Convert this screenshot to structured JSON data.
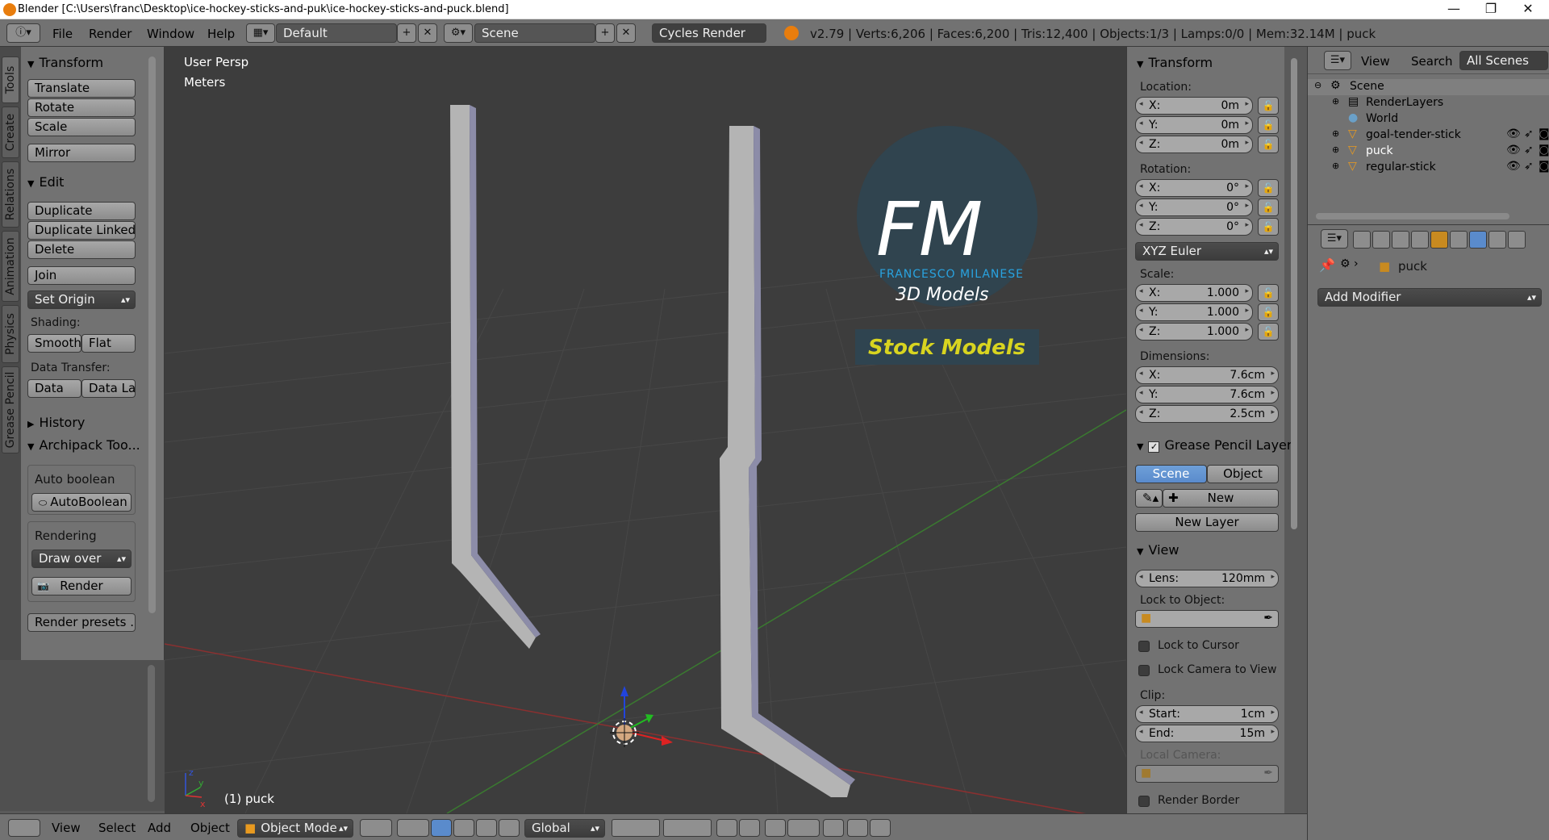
{
  "window": {
    "title": "Blender [C:\\Users\\franc\\Desktop\\ice-hockey-sticks-and-puk\\ice-hockey-sticks-and-puck.blend]",
    "minimize": "—",
    "maximize": "❐",
    "close": "✕"
  },
  "header": {
    "menus": [
      "File",
      "Render",
      "Window",
      "Help"
    ],
    "layout": "Default",
    "scene": "Scene",
    "engine": "Cycles Render",
    "stats": "v2.79 | Verts:6,206 | Faces:6,200 | Tris:12,400 | Objects:1/3 | Lamps:0/0 | Mem:32.14M | puck"
  },
  "side_tabs": [
    "Tools",
    "Create",
    "Relations",
    "Animation",
    "Physics",
    "Grease Pencil"
  ],
  "toolshelf": {
    "transform_title": "Transform",
    "transform_buttons": [
      "Translate",
      "Rotate",
      "Scale",
      "Mirror"
    ],
    "edit_title": "Edit",
    "edit_buttons": [
      "Duplicate",
      "Duplicate Linked",
      "Delete",
      "Join"
    ],
    "set_origin": "Set Origin",
    "shading_label": "Shading:",
    "smooth": "Smooth",
    "flat": "Flat",
    "data_transfer_label": "Data Transfer:",
    "data": "Data",
    "data_la": "Data La",
    "history_title": "History",
    "archipack_title": "Archipack Too...",
    "auto_boolean_label": "Auto boolean",
    "auto_boolean_btn": "AutoBoolean",
    "rendering_label": "Rendering",
    "draw_over": "Draw over",
    "render_btn": "Render",
    "render_presets": "Render presets ..."
  },
  "viewport": {
    "view_name": "User Persp",
    "units": "Meters",
    "active_object": "(1) puck",
    "logo_letters": "FM",
    "logo_name": "FRANCESCO MILANESE",
    "logo_sub": "3D Models",
    "logo_banner": "Stock Models"
  },
  "npanel": {
    "transform_title": "Transform",
    "location_label": "Location:",
    "location": [
      {
        "k": "X:",
        "v": "0m"
      },
      {
        "k": "Y:",
        "v": "0m"
      },
      {
        "k": "Z:",
        "v": "0m"
      }
    ],
    "rotation_label": "Rotation:",
    "rotation": [
      {
        "k": "X:",
        "v": "0°"
      },
      {
        "k": "Y:",
        "v": "0°"
      },
      {
        "k": "Z:",
        "v": "0°"
      }
    ],
    "rotation_mode": "XYZ Euler",
    "scale_label": "Scale:",
    "scale": [
      {
        "k": "X:",
        "v": "1.000"
      },
      {
        "k": "Y:",
        "v": "1.000"
      },
      {
        "k": "Z:",
        "v": "1.000"
      }
    ],
    "dimensions_label": "Dimensions:",
    "dimensions": [
      {
        "k": "X:",
        "v": "7.6cm"
      },
      {
        "k": "Y:",
        "v": "7.6cm"
      },
      {
        "k": "Z:",
        "v": "2.5cm"
      }
    ],
    "gp_title": "Grease Pencil Layer",
    "gp_scene": "Scene",
    "gp_object": "Object",
    "gp_new": "New",
    "gp_new_layer": "New Layer",
    "view_title": "View",
    "lens_key": "Lens:",
    "lens_val": "120mm",
    "lock_object_label": "Lock to Object:",
    "lock_cursor": "Lock to Cursor",
    "lock_camera": "Lock Camera to View",
    "clip_label": "Clip:",
    "clip_start_key": "Start:",
    "clip_start_val": "1cm",
    "clip_end_key": "End:",
    "clip_end_val": "15m",
    "local_camera_label": "Local Camera:",
    "render_border": "Render Border"
  },
  "outliner": {
    "menus": [
      "View",
      "Search"
    ],
    "filter": "All Scenes",
    "items": [
      {
        "label": "Scene",
        "icon": "scene-icon"
      },
      {
        "label": "RenderLayers",
        "icon": "render-layers-icon"
      },
      {
        "label": "World",
        "icon": "world-icon"
      },
      {
        "label": "goal-tender-stick",
        "icon": "mesh-icon"
      },
      {
        "label": "puck",
        "icon": "mesh-icon"
      },
      {
        "label": "regular-stick",
        "icon": "mesh-icon"
      }
    ]
  },
  "properties": {
    "object_name": "puck",
    "add_modifier": "Add Modifier"
  },
  "footer": {
    "menus": [
      "View",
      "Select",
      "Add",
      "Object"
    ],
    "mode": "Object Mode",
    "orientation": "Global"
  },
  "colors": {
    "accent": "#5a8bcc",
    "viewport_bg": "#3d3d3d",
    "panel_bg": "#727272",
    "logo_blue": "#29a3e0",
    "logo_yellow": "#d8d420"
  }
}
